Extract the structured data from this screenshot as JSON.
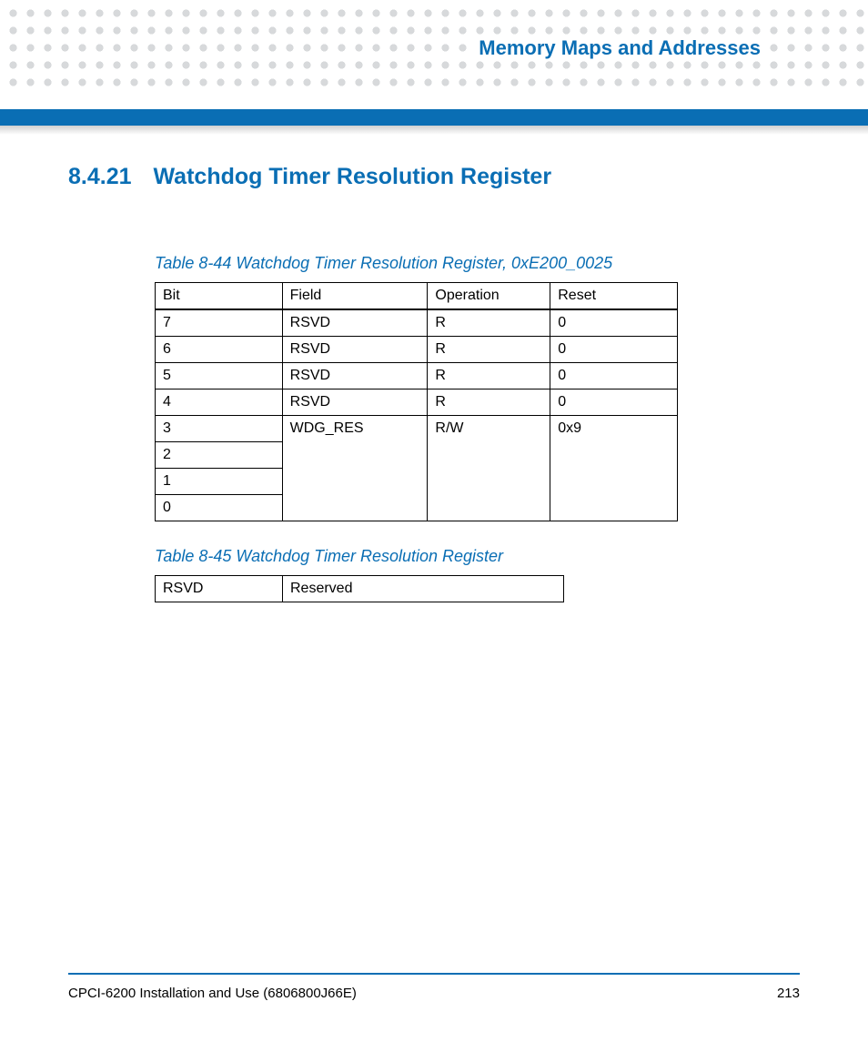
{
  "header": {
    "chapter_title": "Memory Maps and Addresses"
  },
  "section": {
    "number": "8.4.21",
    "title": "Watchdog Timer Resolution Register"
  },
  "table1": {
    "caption": "Table 8-44 Watchdog Timer Resolution Register, 0xE200_0025",
    "headers": {
      "c1": "Bit",
      "c2": "Field",
      "c3": "Operation",
      "c4": "Reset"
    },
    "rows": {
      "r0": {
        "bit": "7",
        "field": "RSVD",
        "op": "R",
        "reset": "0"
      },
      "r1": {
        "bit": "6",
        "field": "RSVD",
        "op": "R",
        "reset": "0"
      },
      "r2": {
        "bit": "5",
        "field": "RSVD",
        "op": "R",
        "reset": "0"
      },
      "r3": {
        "bit": "4",
        "field": "RSVD",
        "op": "R",
        "reset": "0"
      },
      "r4": {
        "bit": "3",
        "field": "WDG_RES",
        "op": "R/W",
        "reset": "0x9"
      },
      "r5": {
        "bit": "2"
      },
      "r6": {
        "bit": "1"
      },
      "r7": {
        "bit": "0"
      }
    }
  },
  "table2": {
    "caption": "Table 8-45 Watchdog Timer Resolution Register",
    "row": {
      "name": "RSVD",
      "desc": "Reserved"
    }
  },
  "footer": {
    "doc": "CPCI-6200 Installation and Use (6806800J66E)",
    "page": "213"
  }
}
